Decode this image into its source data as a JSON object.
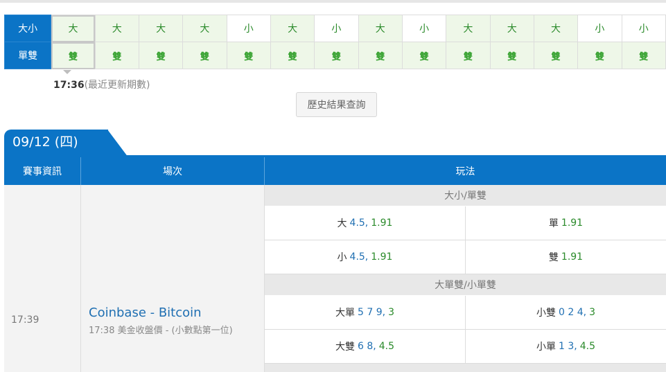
{
  "result_grid": {
    "row1_label": "大小",
    "row2_label": "單雙",
    "row1": [
      "大",
      "大",
      "大",
      "大",
      "小",
      "大",
      "小",
      "大",
      "小",
      "大",
      "大",
      "大",
      "小",
      "小"
    ],
    "row2": [
      "雙",
      "雙",
      "雙",
      "雙",
      "雙",
      "雙",
      "雙",
      "雙",
      "雙",
      "雙",
      "雙",
      "雙",
      "雙",
      "雙"
    ]
  },
  "update": {
    "time": "17:36",
    "note": "(最近更新期數)"
  },
  "history_button": "歷史結果查詢",
  "date_tab": "09/12 (四)",
  "table": {
    "headers": [
      "賽事資訊",
      "場次",
      "玩法"
    ],
    "event_time": "17:39",
    "event_title": "Coinbase - Bitcoin",
    "event_sub": "17:38 美金收盤價 - (小數點第一位)",
    "sections": [
      {
        "label": "大小/單雙",
        "rows": [
          [
            {
              "name": "大",
              "line": "4.5,",
              "odds": "1.91"
            },
            {
              "name": "單",
              "line": "",
              "odds": "1.91"
            }
          ],
          [
            {
              "name": "小",
              "line": "4.5,",
              "odds": "1.91"
            },
            {
              "name": "雙",
              "line": "",
              "odds": "1.91"
            }
          ]
        ]
      },
      {
        "label": "大單雙/小單雙",
        "rows": [
          [
            {
              "name": "大單",
              "line": "5 7 9,",
              "odds": "3"
            },
            {
              "name": "小雙",
              "line": "0 2 4,",
              "odds": "3"
            }
          ],
          [
            {
              "name": "大雙",
              "line": "6 8,",
              "odds": "4.5"
            },
            {
              "name": "小單",
              "line": "1 3,",
              "odds": "4.5"
            }
          ]
        ]
      }
    ]
  },
  "colors": {
    "brand_blue": "#0b74c6",
    "odds_green": "#2a8a2a",
    "line_blue": "#1f6fb2"
  }
}
